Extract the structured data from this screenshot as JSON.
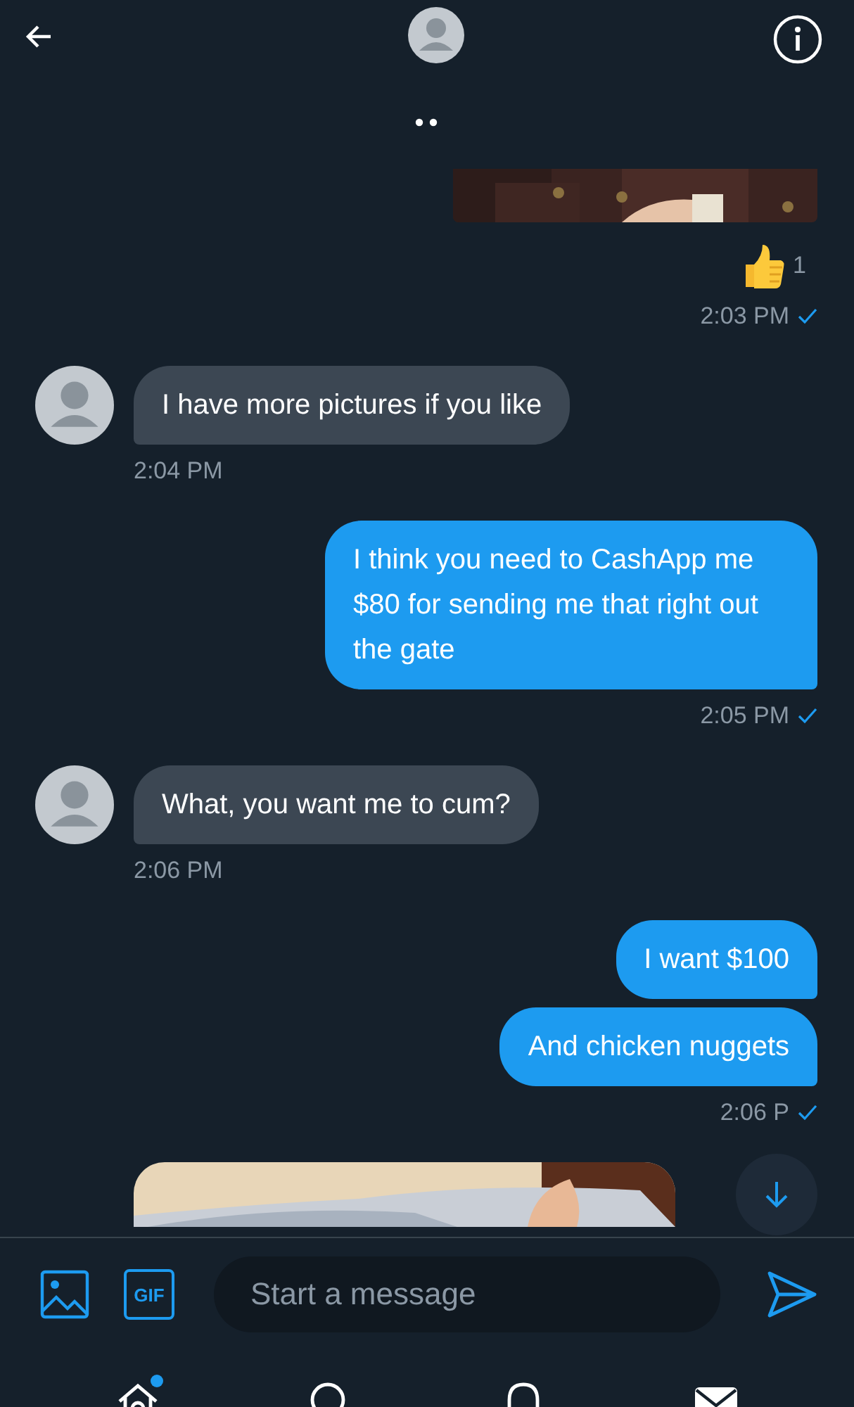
{
  "thread": [
    {
      "kind": "outgoing_photo",
      "reaction_count": "1",
      "time": "2:03 PM",
      "read": true
    },
    {
      "kind": "incoming",
      "text": "I have more pictures if you like",
      "time": "2:04 PM"
    },
    {
      "kind": "outgoing",
      "text": "I think you need to CashApp me $80 for sending me that right out the gate",
      "time": "2:05 PM",
      "read": true
    },
    {
      "kind": "incoming",
      "text": "What, you want me to cum?",
      "time": "2:06 PM"
    },
    {
      "kind": "outgoing",
      "text": "I want $100"
    },
    {
      "kind": "outgoing",
      "text": "And chicken nuggets",
      "time": "2:06 P",
      "read": true
    },
    {
      "kind": "incoming_photo"
    }
  ],
  "composer": {
    "gif_label": "GIF",
    "placeholder": "Start a message"
  },
  "nav": [
    {
      "kind": "home",
      "badge": true
    },
    {
      "kind": "search",
      "badge": false
    },
    {
      "kind": "bell",
      "badge": false
    },
    {
      "kind": "mail",
      "badge": false
    }
  ]
}
